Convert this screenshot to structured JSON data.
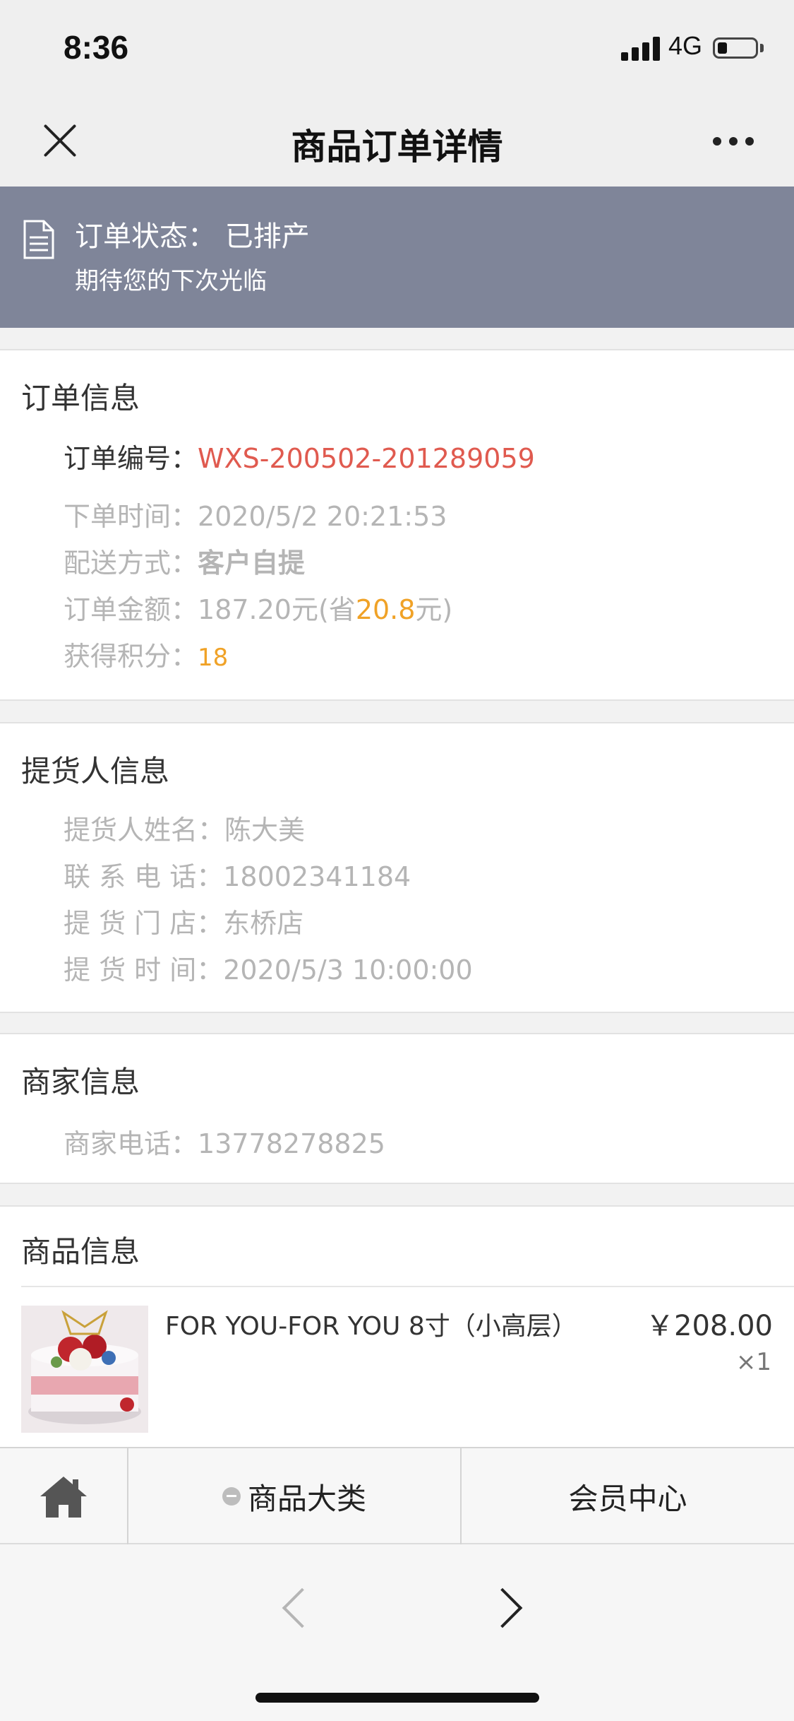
{
  "status_bar": {
    "time": "8:36",
    "network": "4G",
    "battery_level": 0.25
  },
  "nav": {
    "title": "商品订单详情"
  },
  "banner": {
    "status": "订单状态： 已排产",
    "subtitle": "期待您的下次光临"
  },
  "order_info": {
    "title": "订单信息",
    "number_label": "订单编号：",
    "number_value": "WXS-200502-201289059",
    "time_label": "下单时间：",
    "time_value": "2020/5/2 20:21:53",
    "delivery_label": "配送方式：",
    "delivery_value": "客户自提",
    "amount_label": "订单金额：",
    "amount_value": "187.20元(省",
    "amount_saved": "20.8",
    "amount_suffix": "元)",
    "points_label": "获得积分：",
    "points_value": "18"
  },
  "pickup_info": {
    "title": "提货人信息",
    "name_label": "提货人姓名：",
    "name_value": "陈大美",
    "phone_label": "联 系 电 话：",
    "phone_value": "18002341184",
    "store_label": "提 货 门 店：",
    "store_value": "东桥店",
    "time_label": "提 货 时 间：",
    "time_value": "2020/5/3 10:00:00"
  },
  "merchant_info": {
    "title": "商家信息",
    "phone_label": "商家电话：",
    "phone_value": "13778278825"
  },
  "product_info": {
    "title": "商品信息",
    "items": [
      {
        "name": "FOR YOU-FOR YOU 8寸（小高层）",
        "price": "￥208.00",
        "qty": "×1",
        "thumb_icon": "cake-image"
      }
    ]
  },
  "bottom_menu": {
    "home_icon": "home-icon",
    "categories_label": "商品大类",
    "member_label": "会员中心"
  },
  "colors": {
    "banner_bg": "#7f8599",
    "order_number": "#e05a4f",
    "highlight": "#f0a227",
    "muted_text": "#b5b5b5"
  }
}
